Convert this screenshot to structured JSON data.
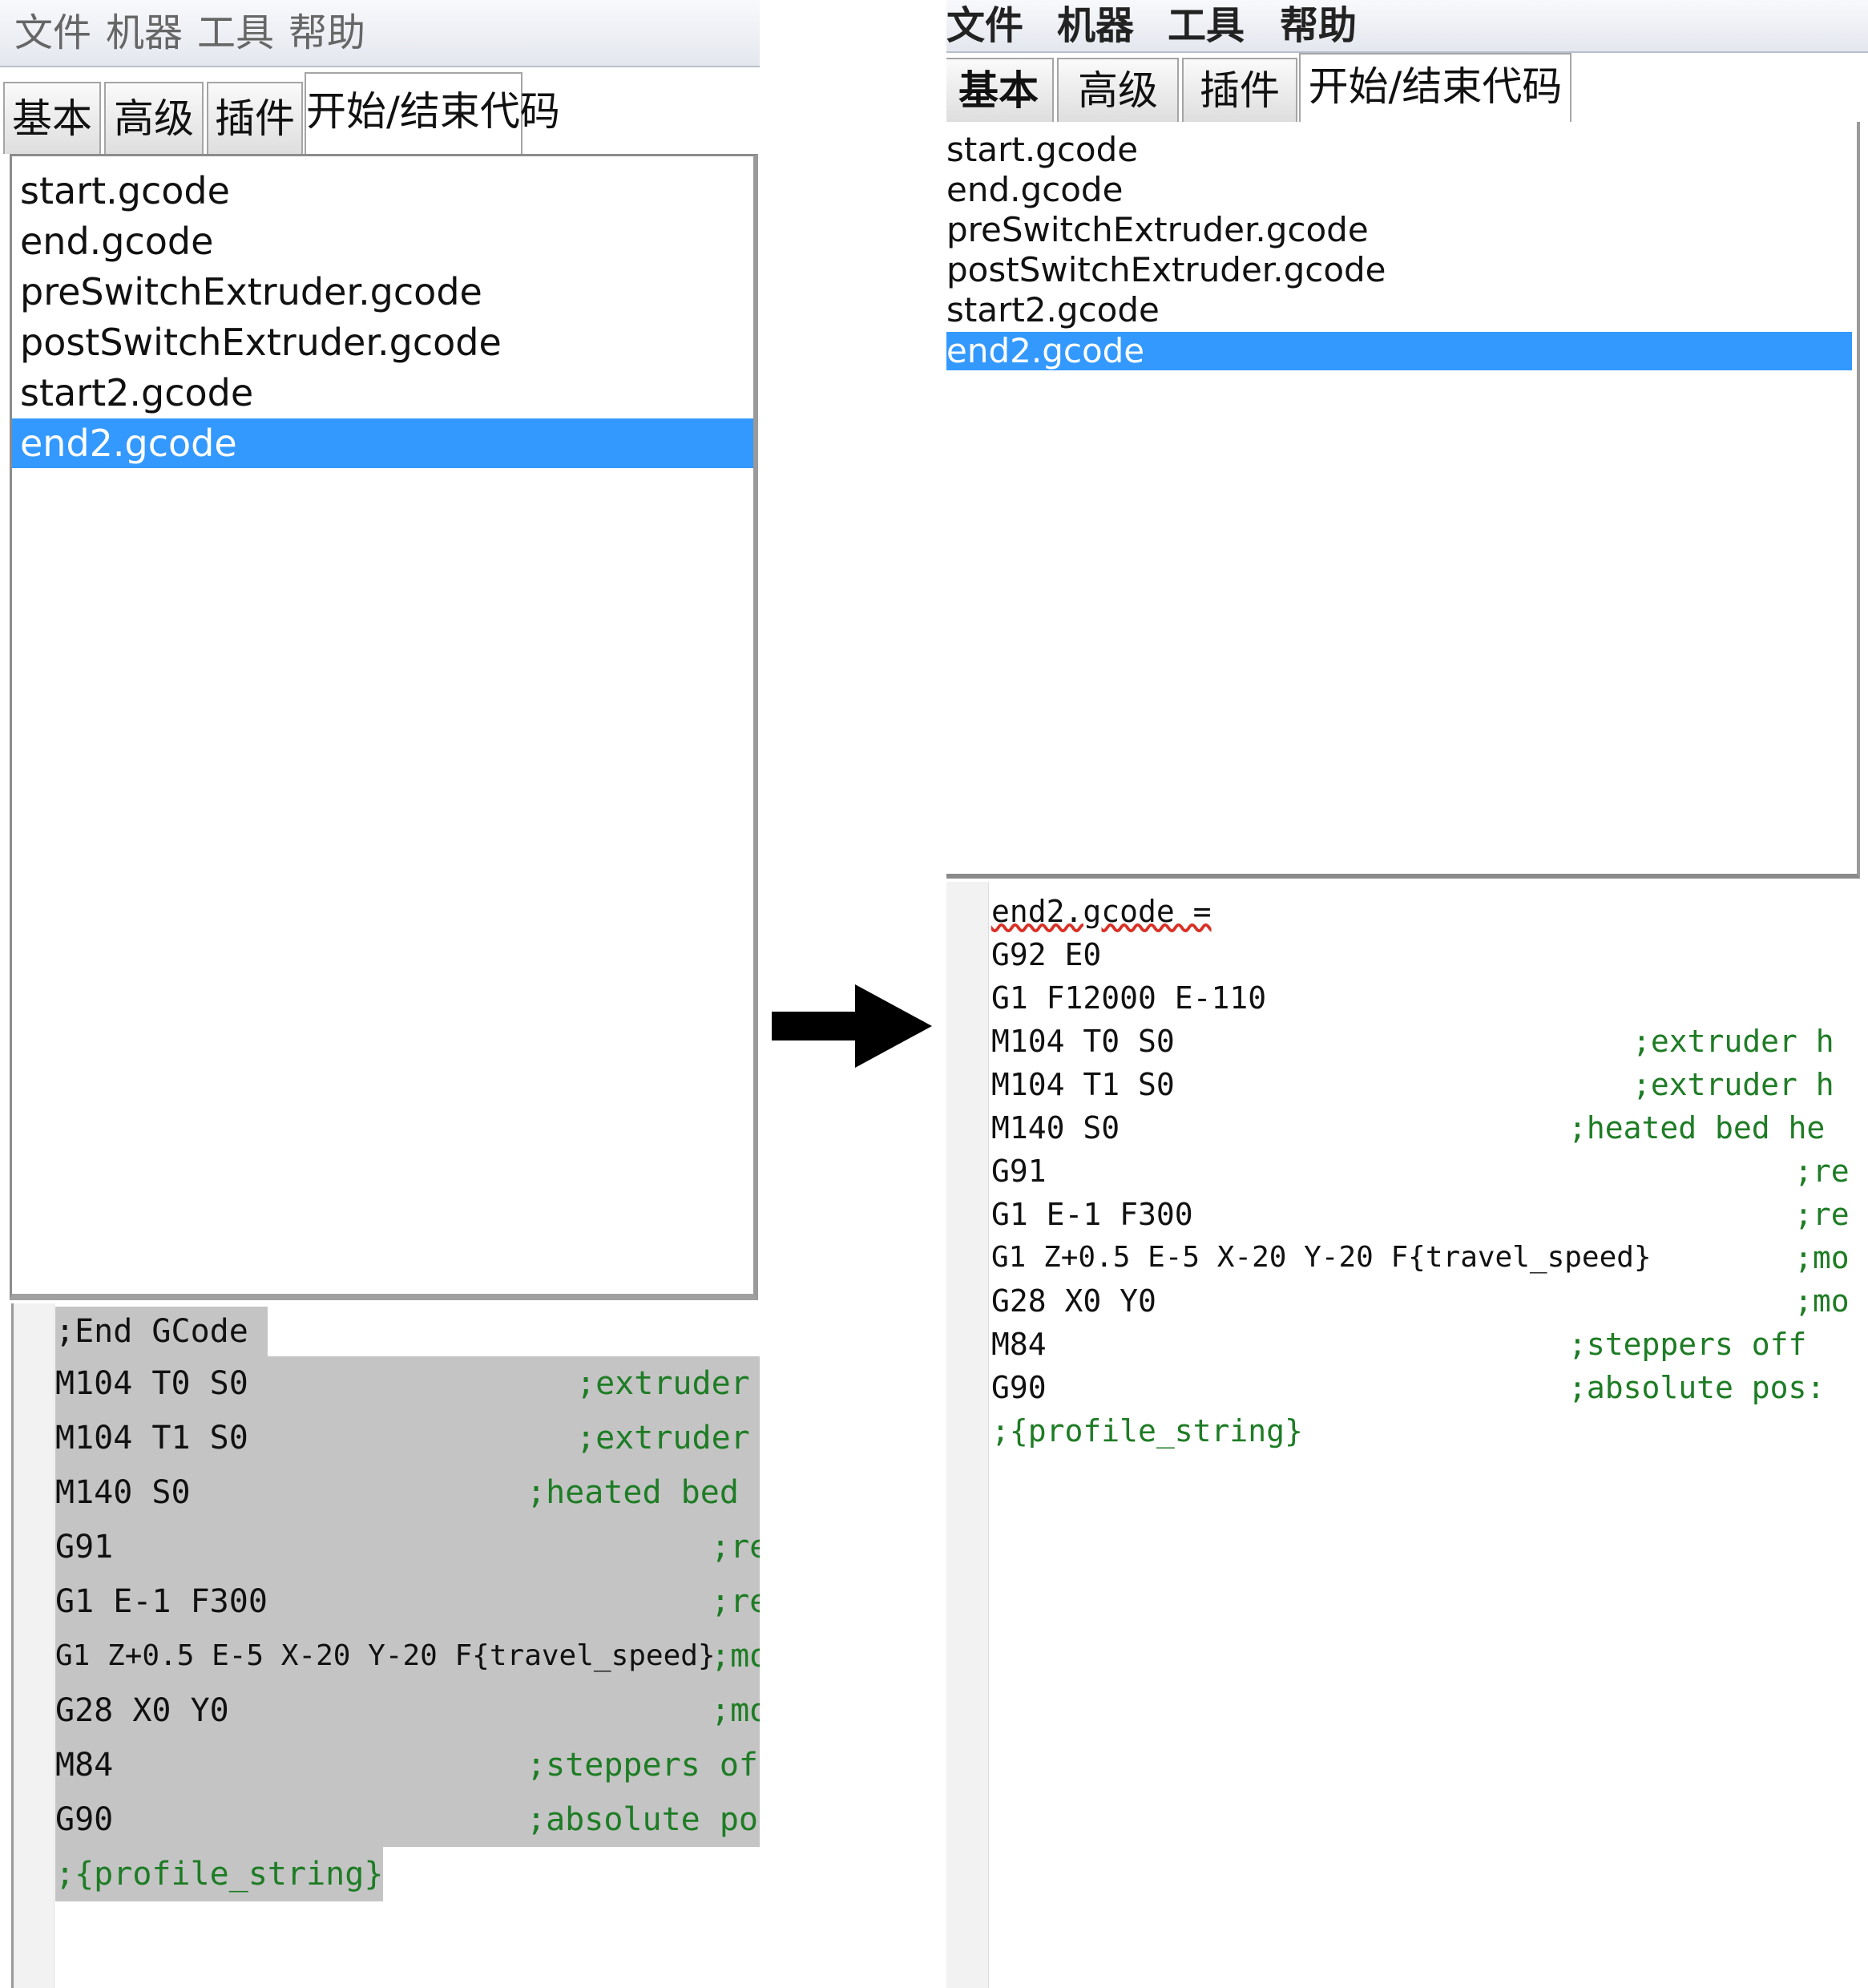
{
  "menu": [
    "文件",
    "机器",
    "工具",
    "帮助"
  ],
  "tabs": [
    "基本",
    "高级",
    "插件",
    "开始/结束代码"
  ],
  "active_tab": "开始/结束代码",
  "files": [
    "start.gcode",
    "end.gcode",
    "preSwitchExtruder.gcode",
    "postSwitchExtruder.gcode",
    "start2.gcode",
    "end2.gcode"
  ],
  "selected_file": "end2.gcode",
  "before": {
    "code": [
      ";End GCode",
      "M104 T0 S0",
      "M104 T1 S0",
      "M140 S0",
      "G91",
      "G1 E-1 F300",
      "G1 Z+0.5 E-5 X-20 Y-20 F{travel_speed}",
      "G28 X0 Y0",
      "M84",
      "G90",
      ";{profile_string}"
    ],
    "comments": [
      "",
      ";extruder h",
      ";extruder h",
      ";heated bed he",
      ";re",
      ";re",
      ";mo",
      ";mo",
      ";steppers off",
      ";absolute pos:",
      ""
    ]
  },
  "after": {
    "code": [
      "end2.gcode =",
      "G92 E0",
      "G1 F12000 E-110",
      "M104 T0 S0",
      "M104 T1 S0",
      "M140 S0",
      "G91",
      "G1 E-1 F300",
      "G1 Z+0.5 E-5 X-20 Y-20 F{travel_speed}",
      "G28 X0 Y0",
      "M84",
      "G90",
      ";{profile_string}"
    ],
    "comments": [
      "",
      "",
      "",
      ";extruder h",
      ";extruder h",
      ";heated bed he",
      ";re",
      ";re",
      ";mo",
      ";mo",
      ";steppers off",
      ";absolute pos:",
      ""
    ]
  },
  "colors": {
    "selection": "#3399ff",
    "comment": "#1e7c25",
    "code_selection": "#c4c4c4"
  },
  "icons": {
    "transition": "right-arrow-icon"
  }
}
